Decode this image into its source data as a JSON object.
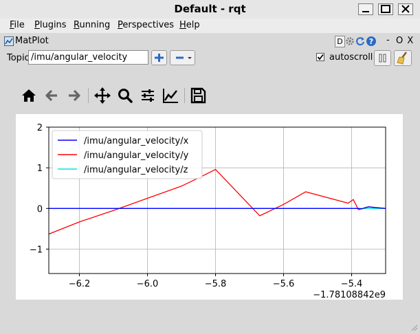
{
  "window": {
    "title": "Default - rqt"
  },
  "menu": [
    {
      "label": "File",
      "mnemonic": "F",
      "rest": "ile"
    },
    {
      "label": "Plugins",
      "mnemonic": "P",
      "rest": "lugins"
    },
    {
      "label": "Running",
      "mnemonic": "R",
      "rest": "unning"
    },
    {
      "label": "Perspectives",
      "mnemonic": "P",
      "rest": "erspectives"
    },
    {
      "label": "Help",
      "mnemonic": "H",
      "rest": "elp"
    }
  ],
  "plugin": {
    "title": "MatPlot",
    "d_label": "D",
    "minimize_label": "-",
    "close_label": "O X"
  },
  "topic": {
    "label": "Topic",
    "value": "/imu/angular_velocity"
  },
  "autoscroll": {
    "label": "autoscroll",
    "checked": true
  },
  "toolbar_icons": [
    "home-icon",
    "back-arrow-icon",
    "forward-arrow-icon",
    "pan-icon",
    "zoom-icon",
    "configure-subplots-icon",
    "edit-axis-icon",
    "save-icon"
  ],
  "chart_data": {
    "type": "line",
    "offset_label": "−1.78108842e9",
    "xlim": [
      -6.29,
      -5.3
    ],
    "ylim": [
      -1.6,
      2.0
    ],
    "xticks": [
      -6.2,
      -6.0,
      -5.8,
      -5.6,
      -5.4
    ],
    "xtick_labels": [
      "−6.2",
      "−6.0",
      "−5.8",
      "−5.6",
      "−5.4"
    ],
    "yticks": [
      2,
      1,
      0,
      -1
    ],
    "ytick_labels": [
      "2",
      "1",
      "0",
      "−1"
    ],
    "grid": true,
    "legend_position": "top-left",
    "series": [
      {
        "name": "/imu/angular_velocity/x",
        "color": "#0000ff",
        "x": [
          -6.29,
          -5.4,
          -5.39,
          -5.38,
          -5.37,
          -5.36,
          -5.35,
          -5.33,
          -5.3
        ],
        "y": [
          0.0,
          0.0,
          0.0,
          0.0,
          -0.01,
          0.02,
          0.04,
          0.02,
          0.0
        ]
      },
      {
        "name": "/imu/angular_velocity/y",
        "color": "#ff0000",
        "x": [
          -6.29,
          -6.2,
          -6.1,
          -6.0,
          -5.9,
          -5.85,
          -5.8,
          -5.67,
          -5.6,
          -5.535,
          -5.41,
          -5.395,
          -5.38,
          -5.35,
          -5.3
        ],
        "y": [
          -0.63,
          -0.33,
          -0.05,
          0.25,
          0.55,
          0.75,
          0.96,
          -0.18,
          0.1,
          0.41,
          0.13,
          0.22,
          -0.03,
          0.04,
          0.0
        ]
      },
      {
        "name": "/imu/angular_velocity/z",
        "color": "#00e5e5",
        "x": [
          -6.29,
          -5.3
        ],
        "y": [
          0.0,
          0.0
        ]
      }
    ]
  }
}
